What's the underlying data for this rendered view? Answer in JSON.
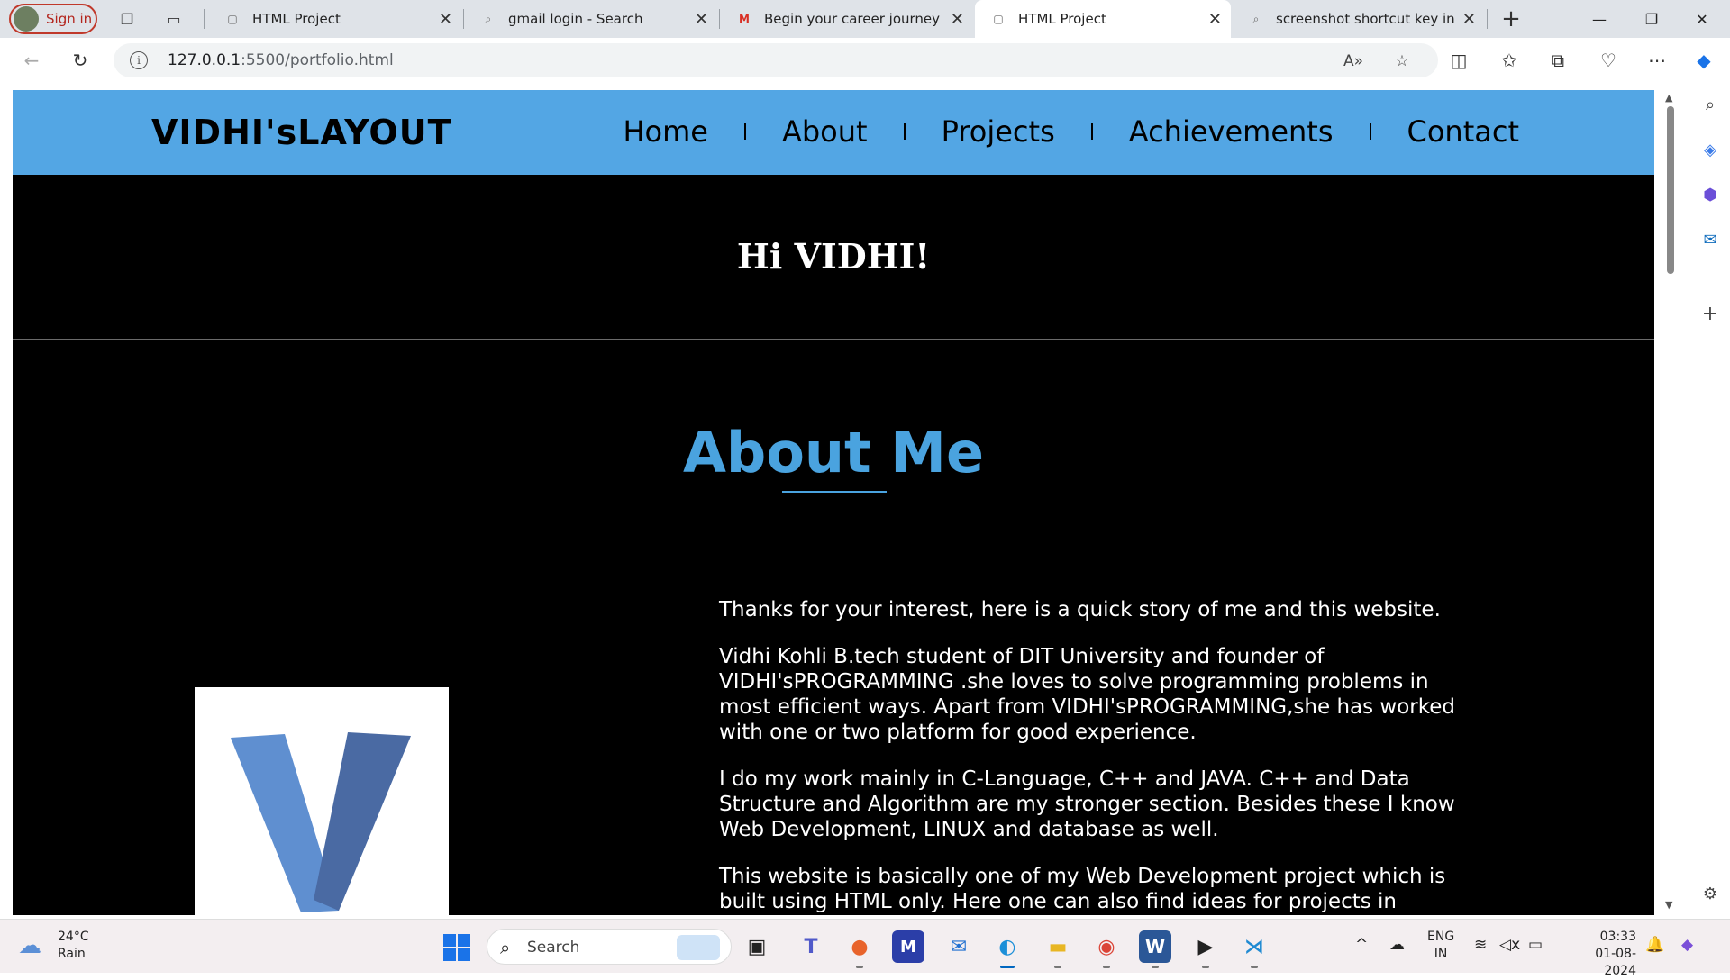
{
  "browser": {
    "signin_label": "Sign in",
    "tabs": [
      {
        "title": "HTML Project",
        "icon": "page-icon",
        "active": false
      },
      {
        "title": "gmail login - Search",
        "icon": "search-icon",
        "active": false
      },
      {
        "title": "Begin your career journey with",
        "icon": "gmail-icon",
        "active": false
      },
      {
        "title": "HTML Project",
        "icon": "page-icon",
        "active": true
      },
      {
        "title": "screenshot shortcut key in lapt",
        "icon": "search-icon",
        "active": false
      }
    ],
    "url_host": "127.0.0.1",
    "url_rest": ":5500/portfolio.html"
  },
  "site": {
    "logo": "VIDHI'sLAYOUT",
    "nav": [
      "Home",
      "About",
      "Projects",
      "Achievements",
      "Contact"
    ],
    "hero_title": "Hi VIDHI!",
    "about_title": "About Me",
    "about_paragraphs": [
      "Thanks for your interest, here is a quick story of me and this website.",
      "Vidhi Kohli B.tech student of DIT University and founder of VIDHI'sPROGRAMMING .she loves to solve programming problems in most efficient ways. Apart from VIDHI'sPROGRAMMING,she has worked with one or two platform for good experience.",
      "I do my work mainly in C-Language, C++ and JAVA. C++ and Data Structure and Algorithm are my stronger section. Besides these I know Web Development, LINUX and database as well.",
      "This website is basically one of my Web Development project which is built using HTML only. Here one can also find ideas for projects in"
    ]
  },
  "taskbar": {
    "temperature": "24°C",
    "weather": "Rain",
    "search_label": "Search",
    "lang_top": "ENG",
    "lang_bottom": "IN",
    "time": "03:33",
    "date": "01-08-2024"
  },
  "colors": {
    "header_blue": "#53a6e4",
    "about_blue": "#4aa3df",
    "logo_v_light": "#5f8fd0",
    "logo_v_dark": "#4a6aa3"
  }
}
